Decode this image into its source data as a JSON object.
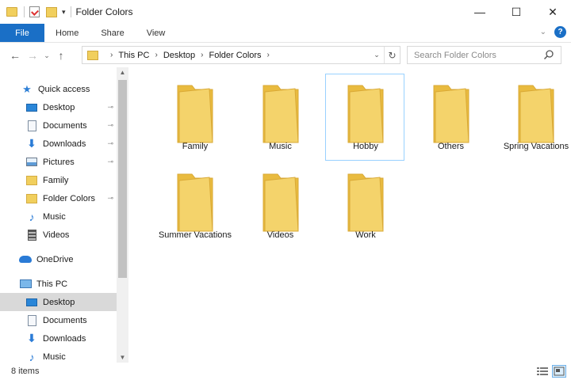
{
  "window": {
    "title": "Folder Colors",
    "controls": {
      "minimize": "—",
      "maximize": "☐",
      "close": "✕"
    }
  },
  "quick_access_toolbar": {
    "dropdown": "▾"
  },
  "ribbon": {
    "tabs": [
      {
        "label": "File"
      },
      {
        "label": "Home"
      },
      {
        "label": "Share"
      },
      {
        "label": "View"
      }
    ],
    "expand_chevron": "⌄",
    "help_label": "?",
    "file_tab_color": "#1a6fc6"
  },
  "navigation": {
    "back": "←",
    "forward": "→",
    "recent": "⌄",
    "up": "↑"
  },
  "address": {
    "breadcrumbs": [
      "This PC",
      "Desktop",
      "Folder Colors"
    ],
    "separator": "›",
    "dropdown": "⌄",
    "refresh": "↻"
  },
  "search": {
    "placeholder": "Search Folder Colors"
  },
  "sidebar": {
    "items": [
      {
        "label": "Quick access",
        "icon": "star-icon"
      },
      {
        "label": "Desktop",
        "icon": "desktop-icon",
        "pinned": true
      },
      {
        "label": "Documents",
        "icon": "documents-icon",
        "pinned": true
      },
      {
        "label": "Downloads",
        "icon": "download-arrow-icon",
        "pinned": true
      },
      {
        "label": "Pictures",
        "icon": "pictures-icon",
        "pinned": true
      },
      {
        "label": "Family",
        "icon": "folder-icon",
        "pinned": false
      },
      {
        "label": "Folder Colors",
        "icon": "folder-icon",
        "pinned": true
      },
      {
        "label": "Music",
        "icon": "music-note-icon",
        "pinned": false
      },
      {
        "label": "Videos",
        "icon": "videos-icon",
        "pinned": false
      },
      {
        "label": "OneDrive",
        "icon": "cloud-icon"
      },
      {
        "label": "This PC",
        "icon": "computer-icon"
      },
      {
        "label": "Desktop",
        "icon": "desktop-icon",
        "selected": true
      },
      {
        "label": "Documents",
        "icon": "documents-icon"
      },
      {
        "label": "Downloads",
        "icon": "download-arrow-icon"
      },
      {
        "label": "Music",
        "icon": "music-note-icon"
      }
    ],
    "pin_glyph": "📌"
  },
  "folders": [
    {
      "name": "Family"
    },
    {
      "name": "Music"
    },
    {
      "name": "Hobby",
      "selected": true
    },
    {
      "name": "Others"
    },
    {
      "name": "Spring Vacations"
    },
    {
      "name": "Summer Vacations"
    },
    {
      "name": "Videos"
    },
    {
      "name": "Work"
    }
  ],
  "folder_colors": {
    "front": "#f4d36b",
    "back": "#e9bb3f",
    "edge": "#d9a936"
  },
  "status": {
    "item_count": "8 items"
  }
}
